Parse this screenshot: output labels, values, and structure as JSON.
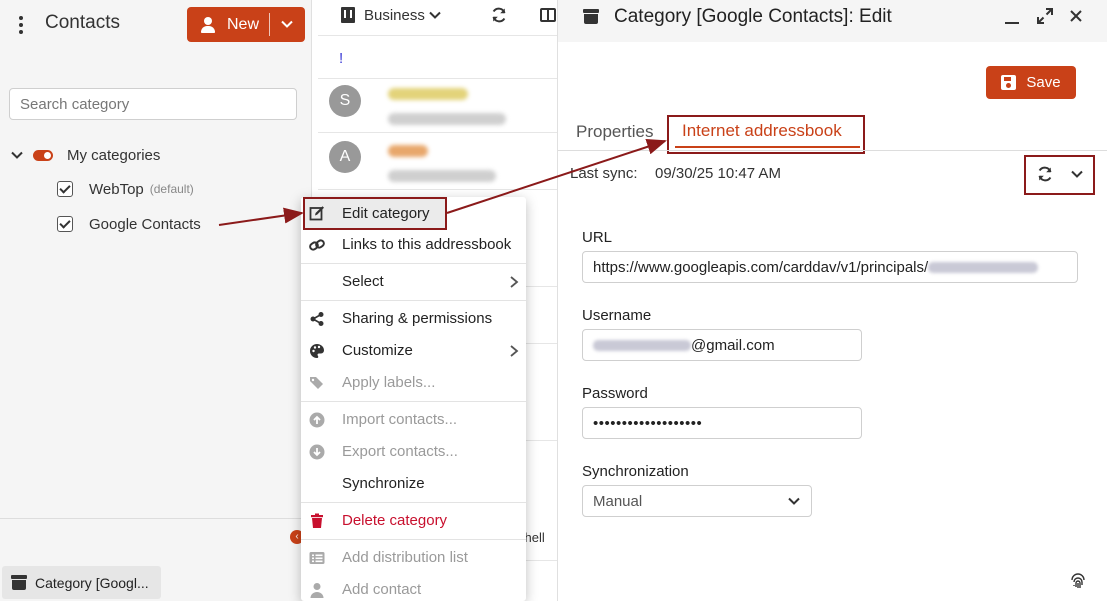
{
  "app": {
    "title": "Contacts",
    "new_label": "New"
  },
  "sidebar": {
    "search_placeholder": "Search category",
    "root_label": "My categories",
    "items": [
      {
        "label": "WebTop",
        "note": "(default)",
        "checked": true
      },
      {
        "label": "Google Contacts",
        "note": "",
        "checked": true
      }
    ]
  },
  "taskbar": {
    "item_label": "Category [Googl..."
  },
  "list": {
    "filter_label": "Business",
    "header_marker": "!",
    "avatars": [
      "S",
      "A"
    ],
    "peek_text": "chell"
  },
  "context_menu": {
    "items": [
      {
        "label": "Edit category",
        "icon": "edit-icon",
        "state": "normal"
      },
      {
        "label": "Links to this addressbook",
        "icon": "link-icon",
        "state": "normal"
      },
      {
        "label": "Select",
        "icon": "",
        "state": "normal",
        "submenu": true
      },
      {
        "label": "Sharing & permissions",
        "icon": "share-icon",
        "state": "normal"
      },
      {
        "label": "Customize",
        "icon": "palette-icon",
        "state": "normal",
        "submenu": true
      },
      {
        "label": "Apply labels...",
        "icon": "tags-icon",
        "state": "disabled"
      },
      {
        "label": "Import contacts...",
        "icon": "import-icon",
        "state": "disabled"
      },
      {
        "label": "Export contacts...",
        "icon": "export-icon",
        "state": "disabled"
      },
      {
        "label": "Synchronize",
        "icon": "",
        "state": "normal"
      },
      {
        "label": "Delete category",
        "icon": "trash-icon",
        "state": "danger"
      },
      {
        "label": "Add distribution list",
        "icon": "list-icon",
        "state": "disabled"
      },
      {
        "label": "Add contact",
        "icon": "person-icon",
        "state": "disabled"
      }
    ]
  },
  "editor": {
    "title": "Category [Google Contacts]: Edit",
    "save_label": "Save",
    "tabs": [
      {
        "label": "Properties",
        "active": false
      },
      {
        "label": "Internet addressbook",
        "active": true
      }
    ],
    "last_sync_label": "Last sync:",
    "last_sync_value": "09/30/25 10:47 AM",
    "fields": {
      "url_label": "URL",
      "url_value": "https://www.googleapis.com/carddav/v1/principals/",
      "username_label": "Username",
      "username_value": "@gmail.com",
      "password_label": "Password",
      "password_value": "•••••••••••••••••••",
      "sync_label": "Synchronization",
      "sync_value": "Manual"
    }
  },
  "colors": {
    "accent": "#c94118",
    "highlight_frame": "#8b1a1a",
    "danger": "#c8102e",
    "link": "#3b3bd6"
  }
}
